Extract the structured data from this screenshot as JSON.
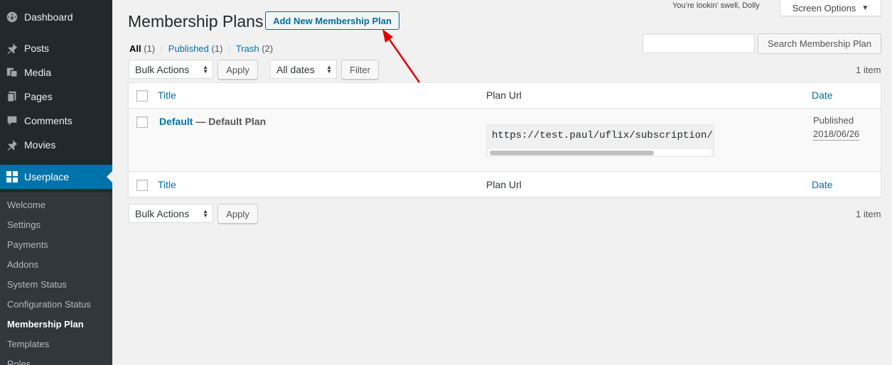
{
  "sidebar": {
    "items": [
      {
        "label": "Dashboard",
        "icon": "dashboard-icon"
      },
      {
        "label": "Posts",
        "icon": "pushpin-icon"
      },
      {
        "label": "Media",
        "icon": "media-icon"
      },
      {
        "label": "Pages",
        "icon": "pages-icon"
      },
      {
        "label": "Comments",
        "icon": "comments-icon"
      },
      {
        "label": "Movies",
        "icon": "pushpin-icon"
      },
      {
        "label": "Userplace",
        "icon": "grid-icon"
      }
    ],
    "submenu": [
      "Welcome",
      "Settings",
      "Payments",
      "Addons",
      "System Status",
      "Configuration Status",
      "Membership Plan",
      "Templates",
      "Roles"
    ]
  },
  "topbar": {
    "howdy": "You’re lookin’ swell, Dolly",
    "screen_options": "Screen Options"
  },
  "header": {
    "title": "Membership Plans",
    "add_new": "Add New Membership Plan"
  },
  "filters": {
    "all": "All",
    "all_count": "(1)",
    "published": "Published",
    "published_count": "(1)",
    "trash": "Trash",
    "trash_count": "(2)",
    "sep": "|"
  },
  "search": {
    "button": "Search Membership Plan",
    "placeholder": ""
  },
  "tablenav": {
    "bulk_actions": "Bulk Actions",
    "apply": "Apply",
    "all_dates": "All dates",
    "filter": "Filter",
    "items_count": "1 item"
  },
  "table": {
    "columns": {
      "title": "Title",
      "plan_url": "Plan Url",
      "date": "Date"
    },
    "rows": [
      {
        "title": "Default",
        "subtitle": " — Default Plan",
        "plan_url": "https://test.paul/uflix/subscription/payment/default",
        "status": "Published",
        "date": "2018/06/26"
      }
    ]
  },
  "colors": {
    "sidebar_bg": "#23282d",
    "submenu_bg": "#32373c",
    "accent": "#0073aa",
    "arrow": "#e00000"
  }
}
